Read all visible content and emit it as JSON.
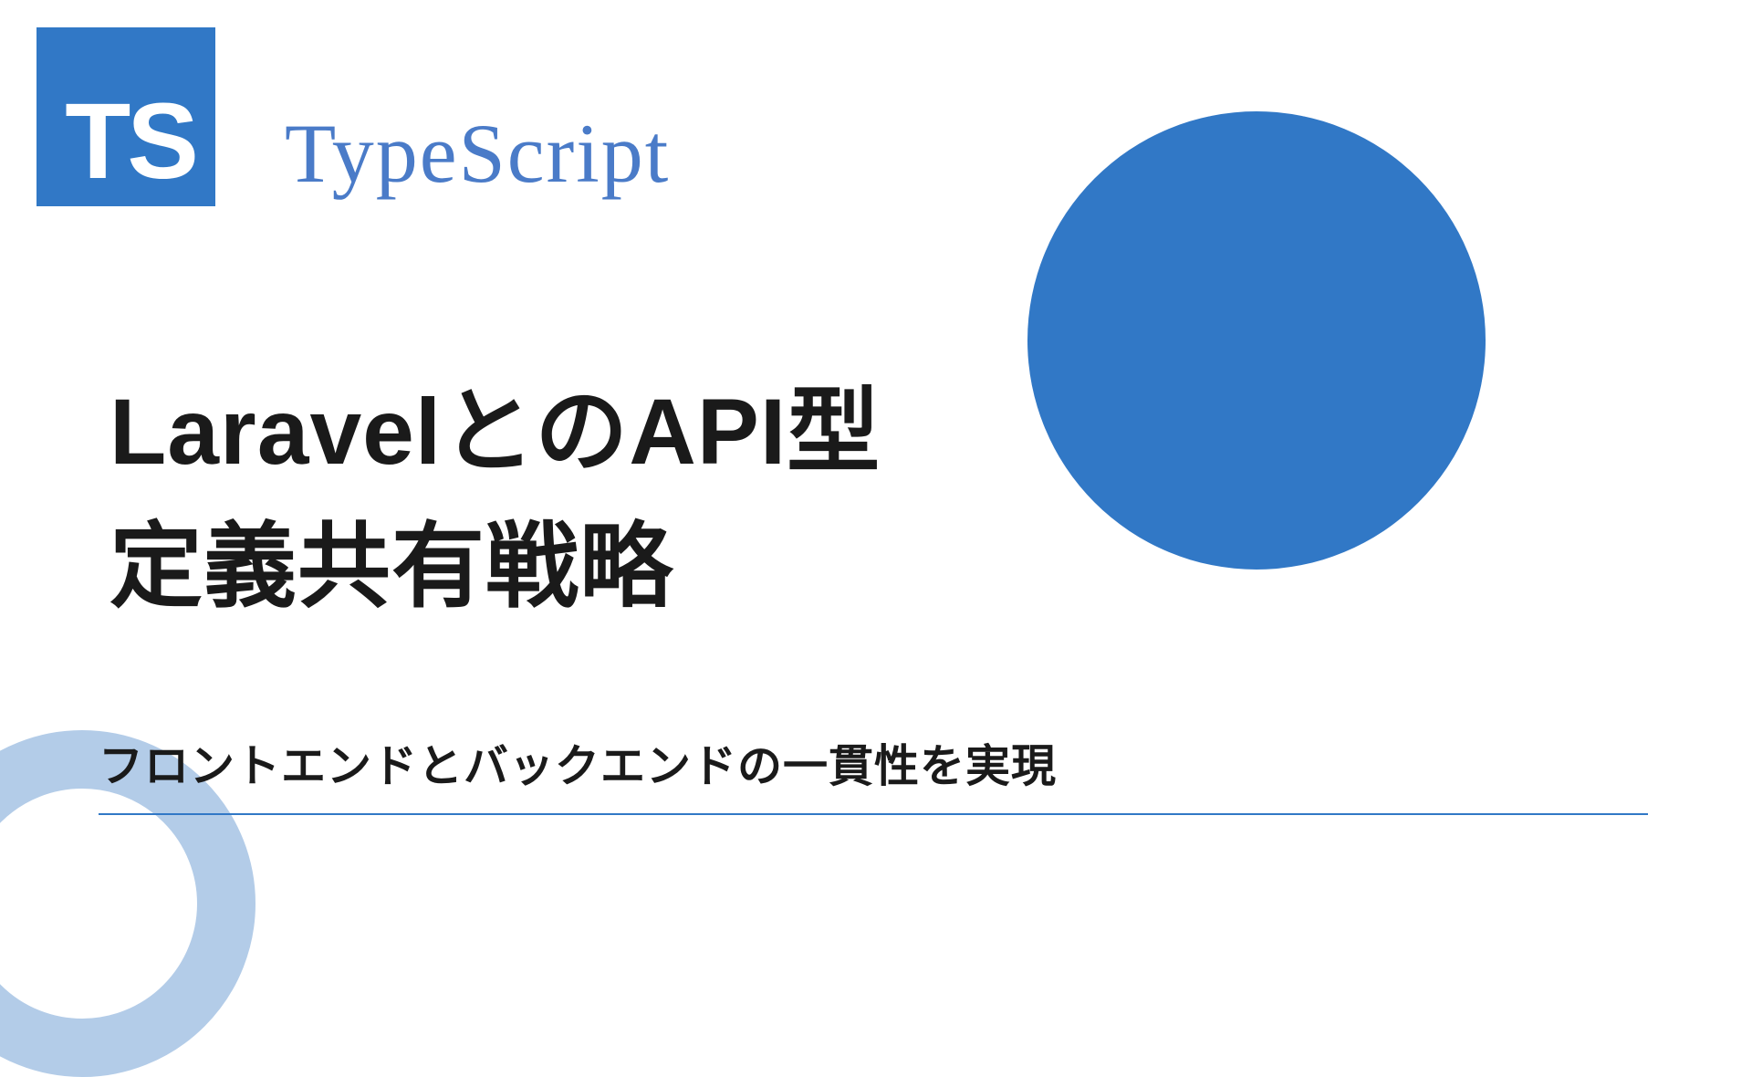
{
  "logo": {
    "text": "TS"
  },
  "header": {
    "label": "TypeScript"
  },
  "title": {
    "line1": "LaravelとのAPI型",
    "line2": "定義共有戦略"
  },
  "subtitle": "フロントエンドとバックエンドの一貫性を実現"
}
